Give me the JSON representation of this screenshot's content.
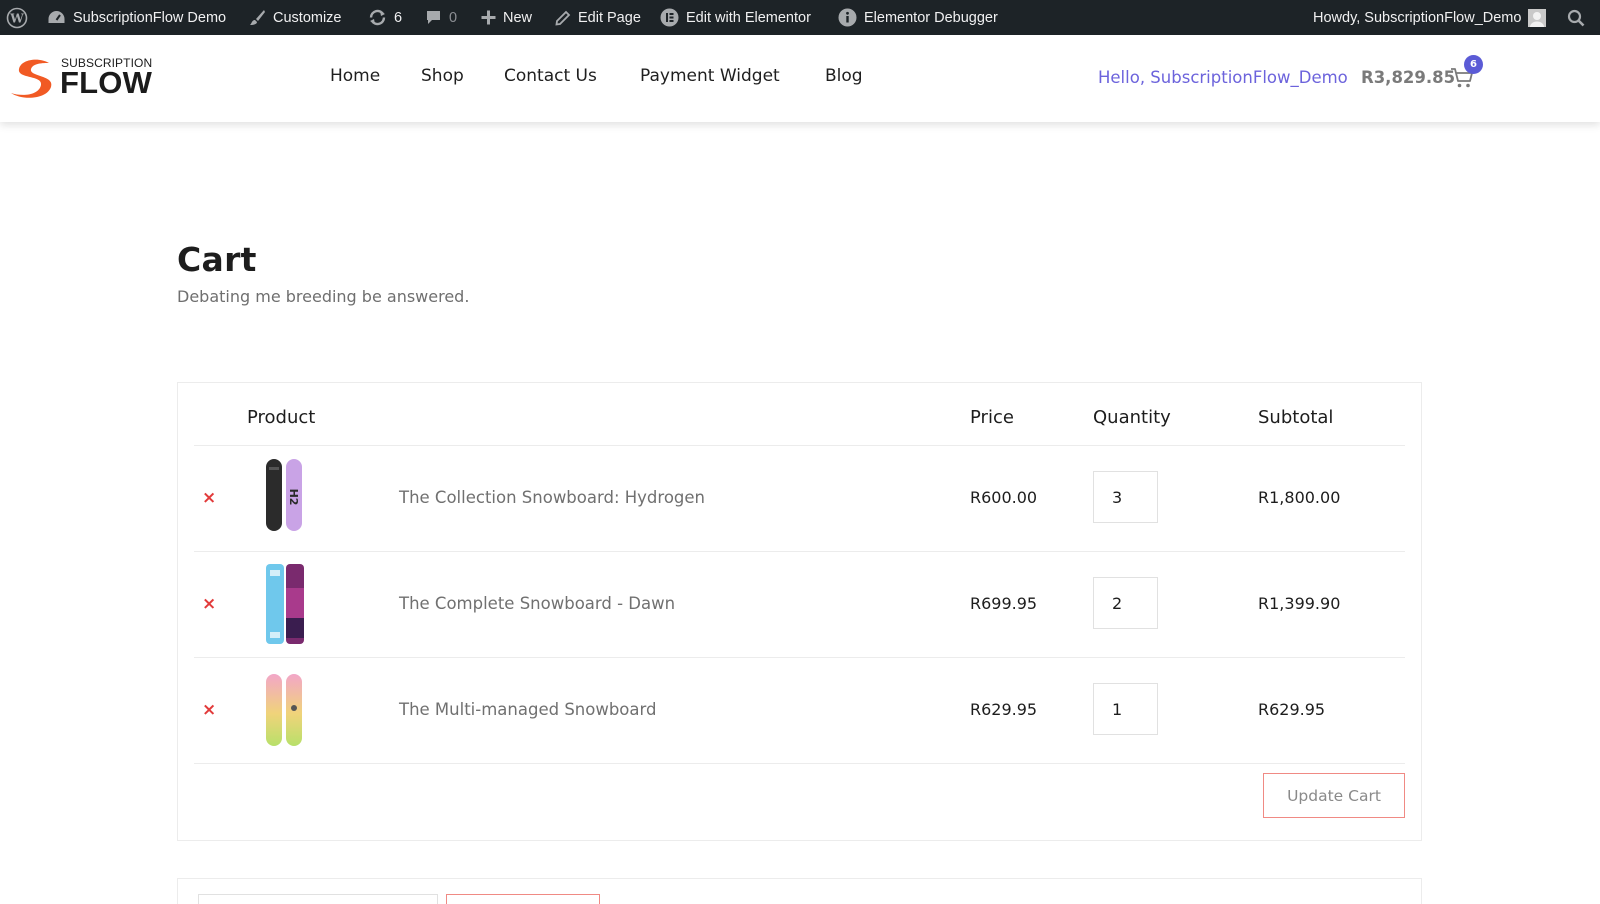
{
  "admin_bar": {
    "site_name": "SubscriptionFlow Demo",
    "customize": "Customize",
    "updates_count": "6",
    "comments_count": "0",
    "new": "New",
    "edit_page": "Edit Page",
    "edit_elementor": "Edit with Elementor",
    "elementor_debugger": "Elementor Debugger",
    "howdy": "Howdy, SubscriptionFlow_Demo"
  },
  "logo": {
    "top_text": "SUBSCRIPTION",
    "main_text": "FLOW",
    "accent_color": "#f15a24"
  },
  "nav": {
    "items": [
      {
        "label": "Home"
      },
      {
        "label": "Shop"
      },
      {
        "label": "Contact Us"
      },
      {
        "label": "Payment Widget"
      },
      {
        "label": "Blog"
      }
    ]
  },
  "header_right": {
    "greeting": "Hello, SubscriptionFlow_Demo",
    "cart_total": "R3,829.85",
    "cart_count": "6",
    "greeting_color": "#6c63dc",
    "badge_color": "#5b5bd6"
  },
  "page": {
    "title": "Cart",
    "subtitle": "Debating me breeding be answered."
  },
  "cart": {
    "headers": {
      "product": "Product",
      "price": "Price",
      "quantity": "Quantity",
      "subtotal": "Subtotal"
    },
    "remove_icon": "×",
    "items": [
      {
        "name": "The Collection Snowboard: Hydrogen",
        "price": "R600.00",
        "quantity": "3",
        "subtotal": "R1,800.00",
        "thumb": "hydrogen-snowboard"
      },
      {
        "name": "The Complete Snowboard - Dawn",
        "price": "R699.95",
        "quantity": "2",
        "subtotal": "R1,399.90",
        "thumb": "dawn-snowboard"
      },
      {
        "name": "The Multi-managed Snowboard",
        "price": "R629.95",
        "quantity": "1",
        "subtotal": "R629.95",
        "thumb": "multi-managed-snowboard"
      }
    ],
    "update_button": "Update Cart",
    "remove_color": "#e23b3b",
    "button_border_color": "#f08a84"
  }
}
